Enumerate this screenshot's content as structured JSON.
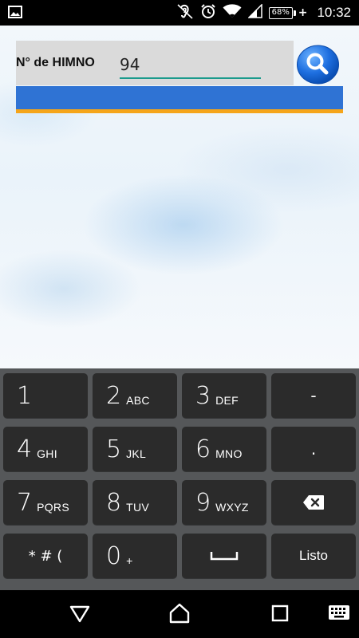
{
  "status_bar": {
    "battery_percent": "68%",
    "time": "10:32",
    "icons": [
      "image-notification-icon",
      "hearing-aid-icon",
      "alarm-icon",
      "wifi-icon",
      "signal-icon",
      "battery-icon"
    ]
  },
  "search_form": {
    "label": "N° de HIMNO",
    "input_value": "94",
    "search_icon": "magnifier-icon"
  },
  "keyboard": {
    "rows": [
      [
        {
          "main": "1",
          "sub": ""
        },
        {
          "main": "2",
          "sub": "ABC"
        },
        {
          "main": "3",
          "sub": "DEF"
        },
        {
          "main": "-",
          "sub": ""
        }
      ],
      [
        {
          "main": "4",
          "sub": "GHI"
        },
        {
          "main": "5",
          "sub": "JKL"
        },
        {
          "main": "6",
          "sub": "MNO"
        },
        {
          "main": ".",
          "sub": ""
        }
      ],
      [
        {
          "main": "7",
          "sub": "PQRS"
        },
        {
          "main": "8",
          "sub": "TUV"
        },
        {
          "main": "9",
          "sub": "WXYZ"
        },
        {
          "main": "",
          "sub": ""
        }
      ],
      [
        {
          "main": "* # (",
          "sub": ""
        },
        {
          "main": "0",
          "sub": "+"
        },
        {
          "main": "",
          "sub": ""
        },
        {
          "main": "Listo",
          "sub": ""
        }
      ]
    ]
  },
  "colors": {
    "accent_blue": "#2f73d4",
    "accent_orange": "#f5a51a",
    "input_underline": "#1a9a8c",
    "keyboard_bg": "#555759",
    "key_bg": "#2b2b2b"
  }
}
